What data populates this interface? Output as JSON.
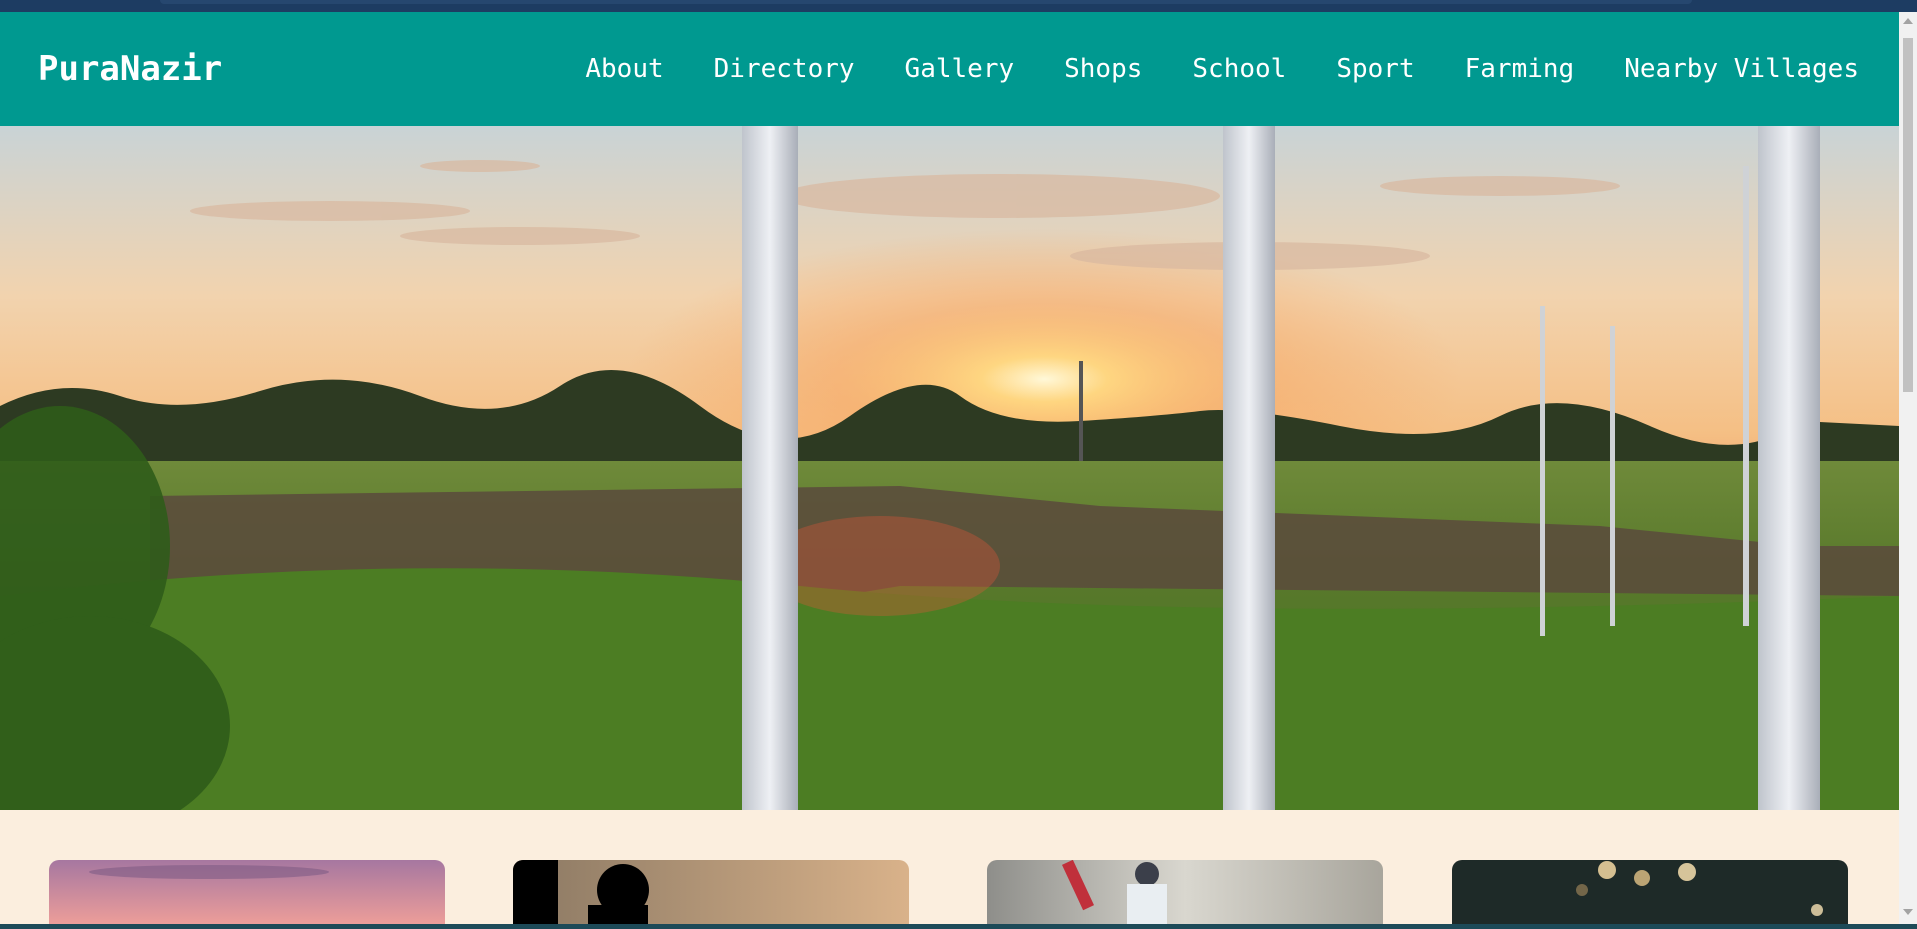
{
  "brand": "PuraNazir",
  "nav": {
    "items": [
      {
        "label": "About"
      },
      {
        "label": "Directory"
      },
      {
        "label": "Gallery"
      },
      {
        "label": "Shops"
      },
      {
        "label": "School"
      },
      {
        "label": "Sport"
      },
      {
        "label": "Farming"
      },
      {
        "label": "Nearby Villages"
      }
    ]
  },
  "colors": {
    "navbar": "#009990",
    "page_background": "#fbeede",
    "nav_text": "#ffffff"
  },
  "hero": {
    "image": "sunset-over-farm-fields-with-white-tree-trunks"
  },
  "cards": [
    {
      "image": "pink-sunset-sky"
    },
    {
      "image": "silhouettes-at-dusk"
    },
    {
      "image": "cricket-batsman"
    },
    {
      "image": "bokeh-lights-night"
    }
  ]
}
